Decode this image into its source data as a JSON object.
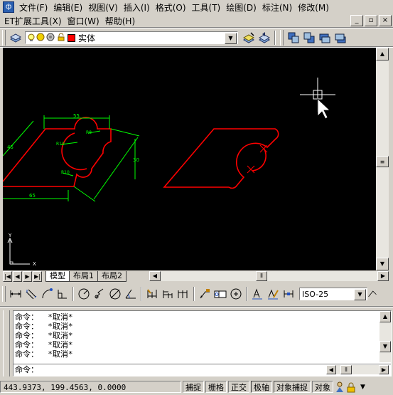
{
  "menu_row1": [
    "文件(F)",
    "编辑(E)",
    "视图(V)",
    "插入(I)",
    "格式(O)",
    "工具(T)",
    "绘图(D)",
    "标注(N)",
    "修改(M)"
  ],
  "menu_row2": [
    "ET扩展工具(X)",
    "窗口(W)",
    "帮助(H)"
  ],
  "layer_combo": {
    "value": "实体",
    "color": "#ff0000"
  },
  "dimstyle_combo": {
    "value": "ISO-25"
  },
  "layout_tabs": [
    {
      "label": "模型",
      "active": true
    },
    {
      "label": "布局1",
      "active": false
    },
    {
      "label": "布局2",
      "active": false
    }
  ],
  "ucs": {
    "y_label": "Y",
    "x_label": "X"
  },
  "drawing_dims": {
    "top": "55",
    "left": "45",
    "right": "30",
    "bottom": "65",
    "r_top": "R8",
    "r_mid": "R10",
    "r_low": "R10"
  },
  "command_history": [
    "命令：  *取消*",
    "命令：  *取消*",
    "命令：  *取消*",
    "命令：  *取消*",
    "命令：  *取消*"
  ],
  "command_prompt": "命令：",
  "status": {
    "coords": "443.9373,  199.4563,  0.0000",
    "buttons": [
      "捕捉",
      "栅格",
      "正交",
      "极轴",
      "对象捕捉",
      "对象"
    ]
  },
  "colors": {
    "canvas_bg": "#000000",
    "outline": "#ff0000",
    "dimension": "#00ff00",
    "cursor": "#ffffff",
    "chrome": "#d4d0c8"
  }
}
